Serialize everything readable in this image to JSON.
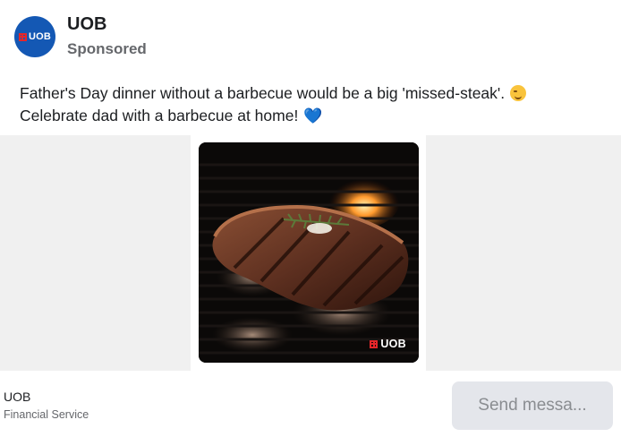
{
  "post": {
    "page_name": "UOB",
    "sponsored_label": "Sponsored",
    "avatar_text": "UOB",
    "text_line_1": "Father's Day dinner without a barbecue would be a big 'missed-steak'.",
    "text_line_2": "Celebrate dad with a barbecue at home!",
    "emoji_1": "smirking-face",
    "emoji_2": "blue-heart",
    "heart_glyph": "💙"
  },
  "ad": {
    "image_subject": "grilled steak with rosemary on barbecue grill",
    "logo_text": "UOB"
  },
  "footer": {
    "advertiser": "UOB",
    "category": "Financial Service",
    "cta_label": "Send messa..."
  },
  "colors": {
    "brand_blue": "#1458b4",
    "brand_red": "#e4262a",
    "heart": "#2f8fe0",
    "media_bg": "#f0f0f0",
    "button_bg": "#e4e6eb"
  }
}
